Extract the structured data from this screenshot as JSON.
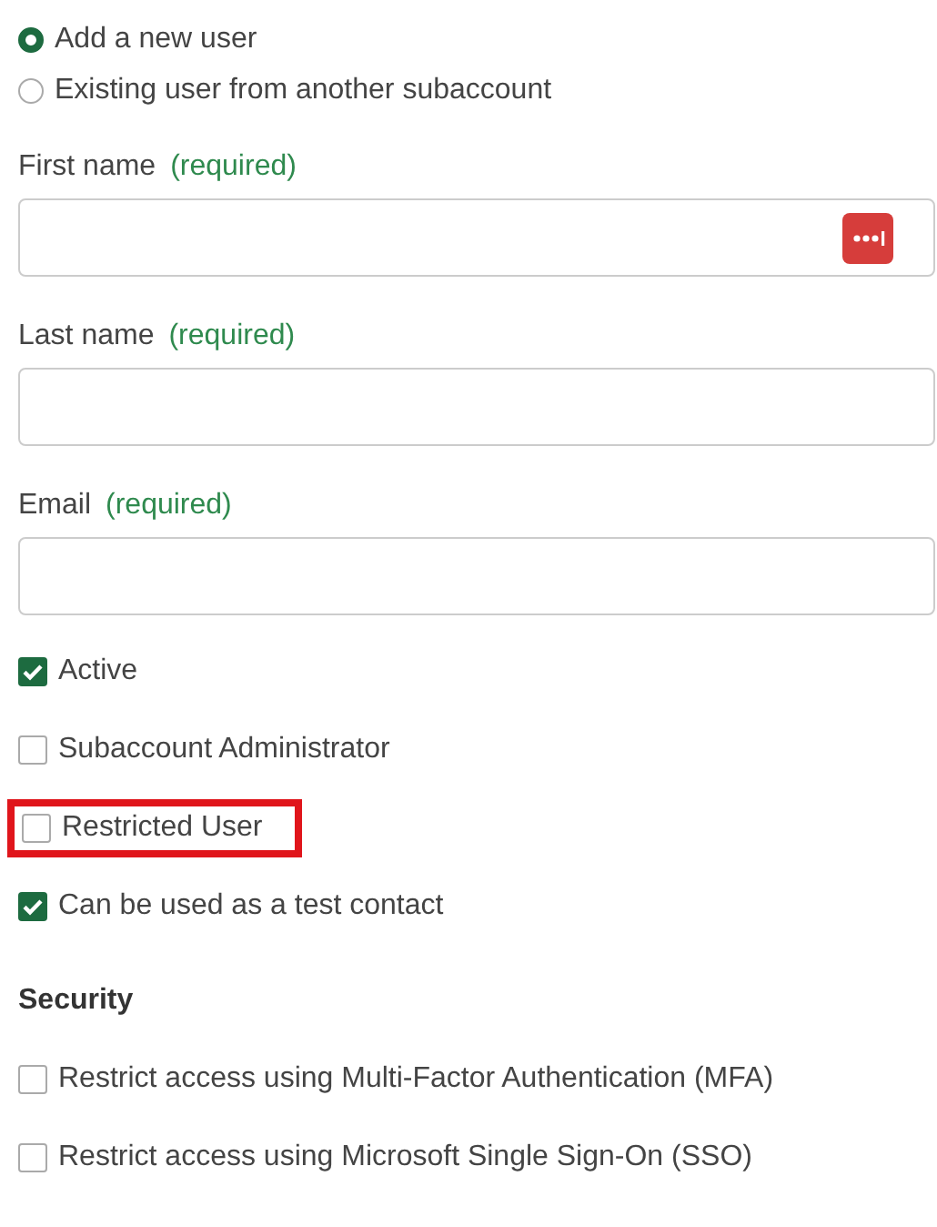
{
  "user_source": [
    {
      "label": "Add a new user",
      "selected": true
    },
    {
      "label": "Existing user from another subaccount",
      "selected": false
    }
  ],
  "fields": [
    {
      "label": "First name",
      "hint": "(required)",
      "password_manager": true
    },
    {
      "label": "Last name",
      "hint": "(required)",
      "password_manager": false
    },
    {
      "label": "Email",
      "hint": "(required)",
      "password_manager": false
    }
  ],
  "options": [
    {
      "label": "Active",
      "checked": true,
      "highlighted": false
    },
    {
      "label": "Subaccount Administrator",
      "checked": false,
      "highlighted": false
    },
    {
      "label": "Restricted User",
      "checked": false,
      "highlighted": true
    },
    {
      "label": "Can be used as a test contact",
      "checked": true,
      "highlighted": false
    }
  ],
  "security": {
    "heading": "Security",
    "options": [
      {
        "label": "Restrict access using Multi-Factor Authentication (MFA)",
        "checked": false
      },
      {
        "label": "Restrict access using Microsoft Single Sign-On (SSO)",
        "checked": false
      }
    ]
  }
}
